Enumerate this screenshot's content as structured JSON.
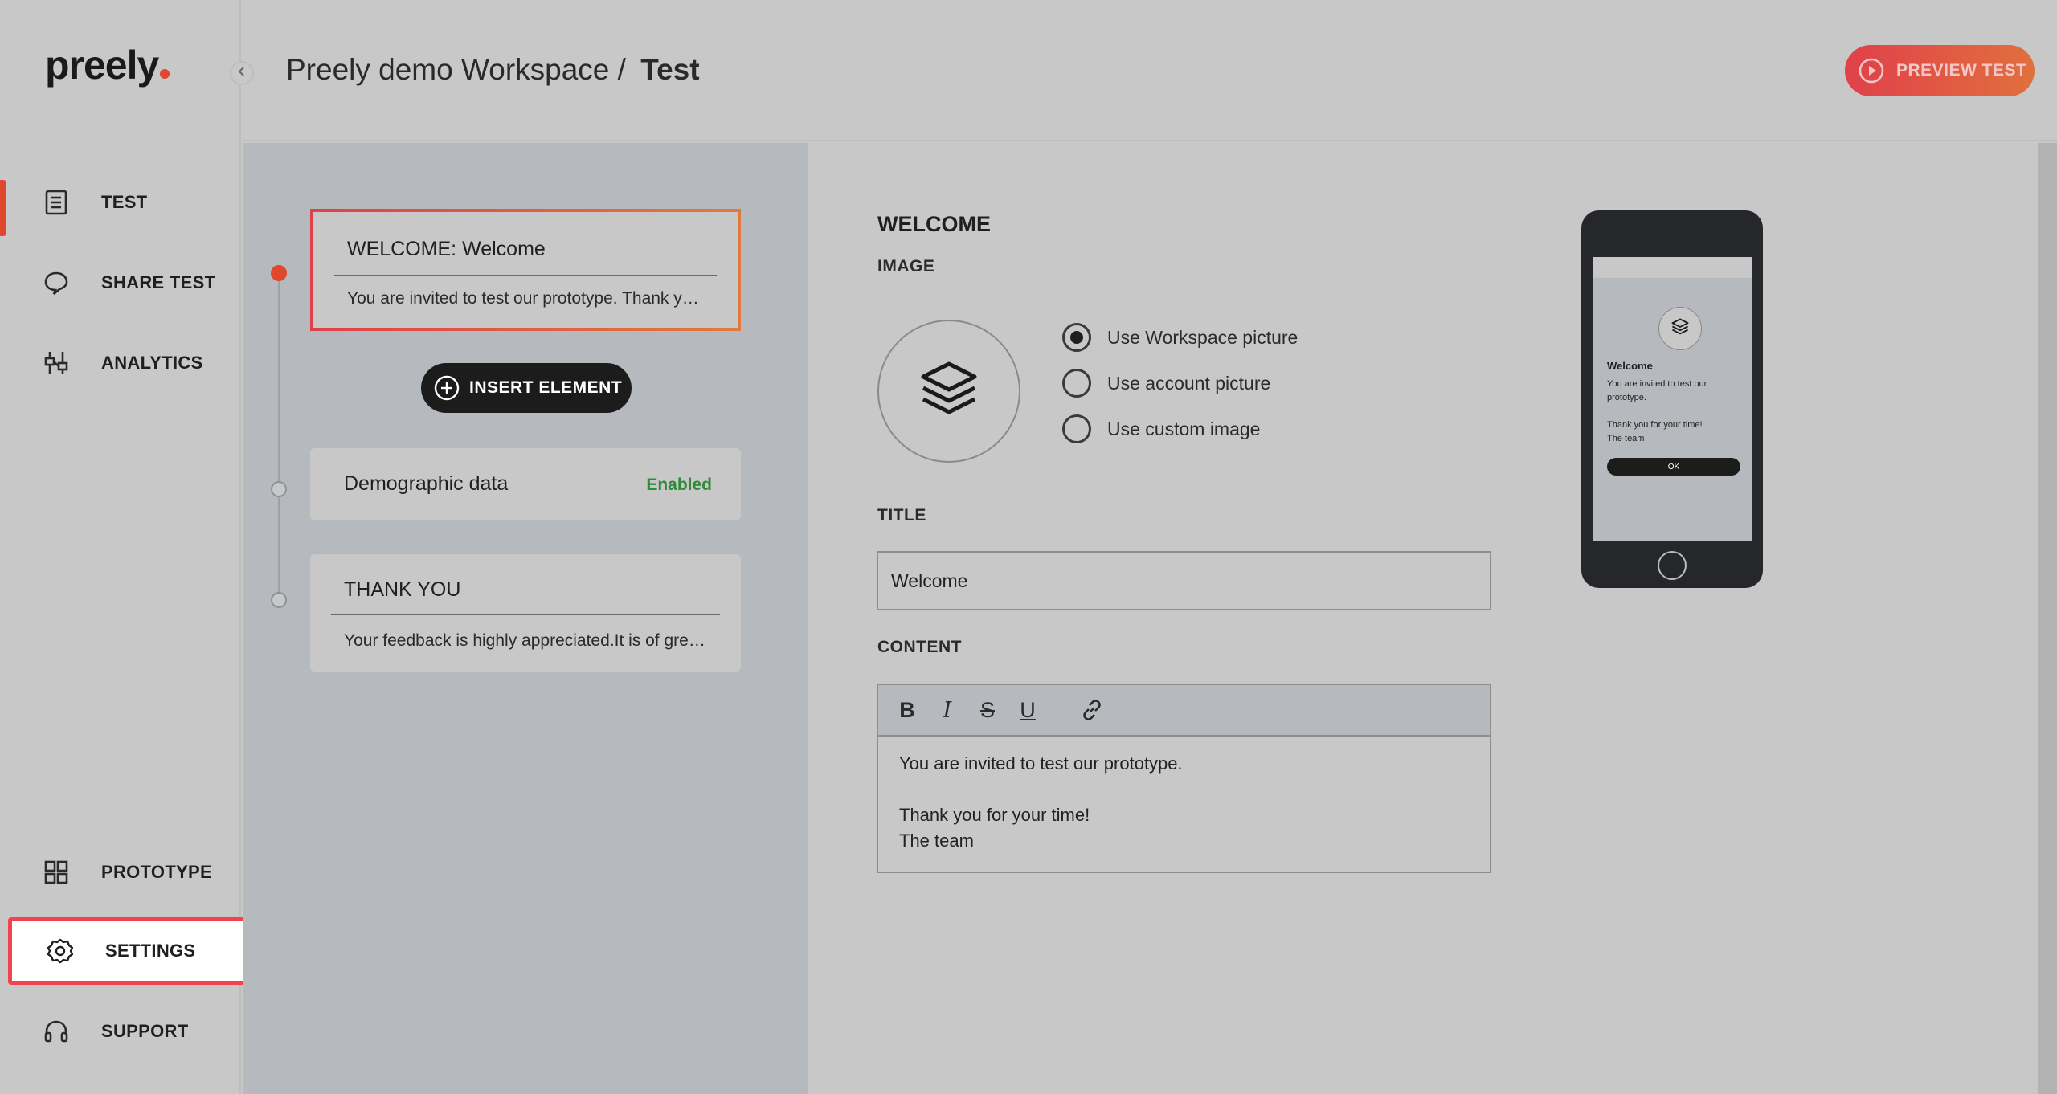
{
  "app": {
    "logo_text": "preely",
    "accent_color": "#e0472f"
  },
  "sidebar": {
    "items": [
      {
        "label": "TEST",
        "icon": "document-icon",
        "active": true
      },
      {
        "label": "SHARE TEST",
        "icon": "chat-bubble-icon"
      },
      {
        "label": "ANALYTICS",
        "icon": "sliders-icon"
      },
      {
        "label": "PROTOTYPE",
        "icon": "grid-icon"
      },
      {
        "label": "SETTINGS",
        "icon": "gear-icon",
        "highlighted": true
      },
      {
        "label": "SUPPORT",
        "icon": "headset-icon"
      }
    ]
  },
  "header": {
    "workspace": "Preely demo Workspace /",
    "current": "Test",
    "preview_label": "PREVIEW TEST"
  },
  "flow": {
    "welcome_card": {
      "title": "WELCOME:  Welcome",
      "body": "You are invited to test our prototype. Thank you for your time!"
    },
    "insert_label": "INSERT ELEMENT",
    "demographic_card": {
      "title": "Demographic data",
      "status": "Enabled"
    },
    "thankyou_card": {
      "title": "THANK YOU",
      "body": "Your feedback is highly appreciated.It is of great value to us."
    }
  },
  "editor": {
    "section_title": "WELCOME",
    "image_label": "IMAGE",
    "image_options": [
      {
        "label": "Use Workspace picture",
        "selected": true
      },
      {
        "label": "Use account picture",
        "selected": false
      },
      {
        "label": "Use custom image",
        "selected": false
      }
    ],
    "title_label": "TITLE",
    "title_value": "Welcome",
    "content_label": "CONTENT",
    "toolbar": [
      "bold",
      "italic",
      "strikethrough",
      "underline",
      "link"
    ],
    "content_lines": {
      "line1": "You are invited to test our prototype.",
      "line2": "Thank you for your time!",
      "line3": "The team"
    }
  },
  "phone_preview": {
    "title": "Welcome",
    "line1": "You are invited to test our prototype.",
    "line2": "Thank you for your time!",
    "line3": "The team",
    "button": "OK"
  }
}
